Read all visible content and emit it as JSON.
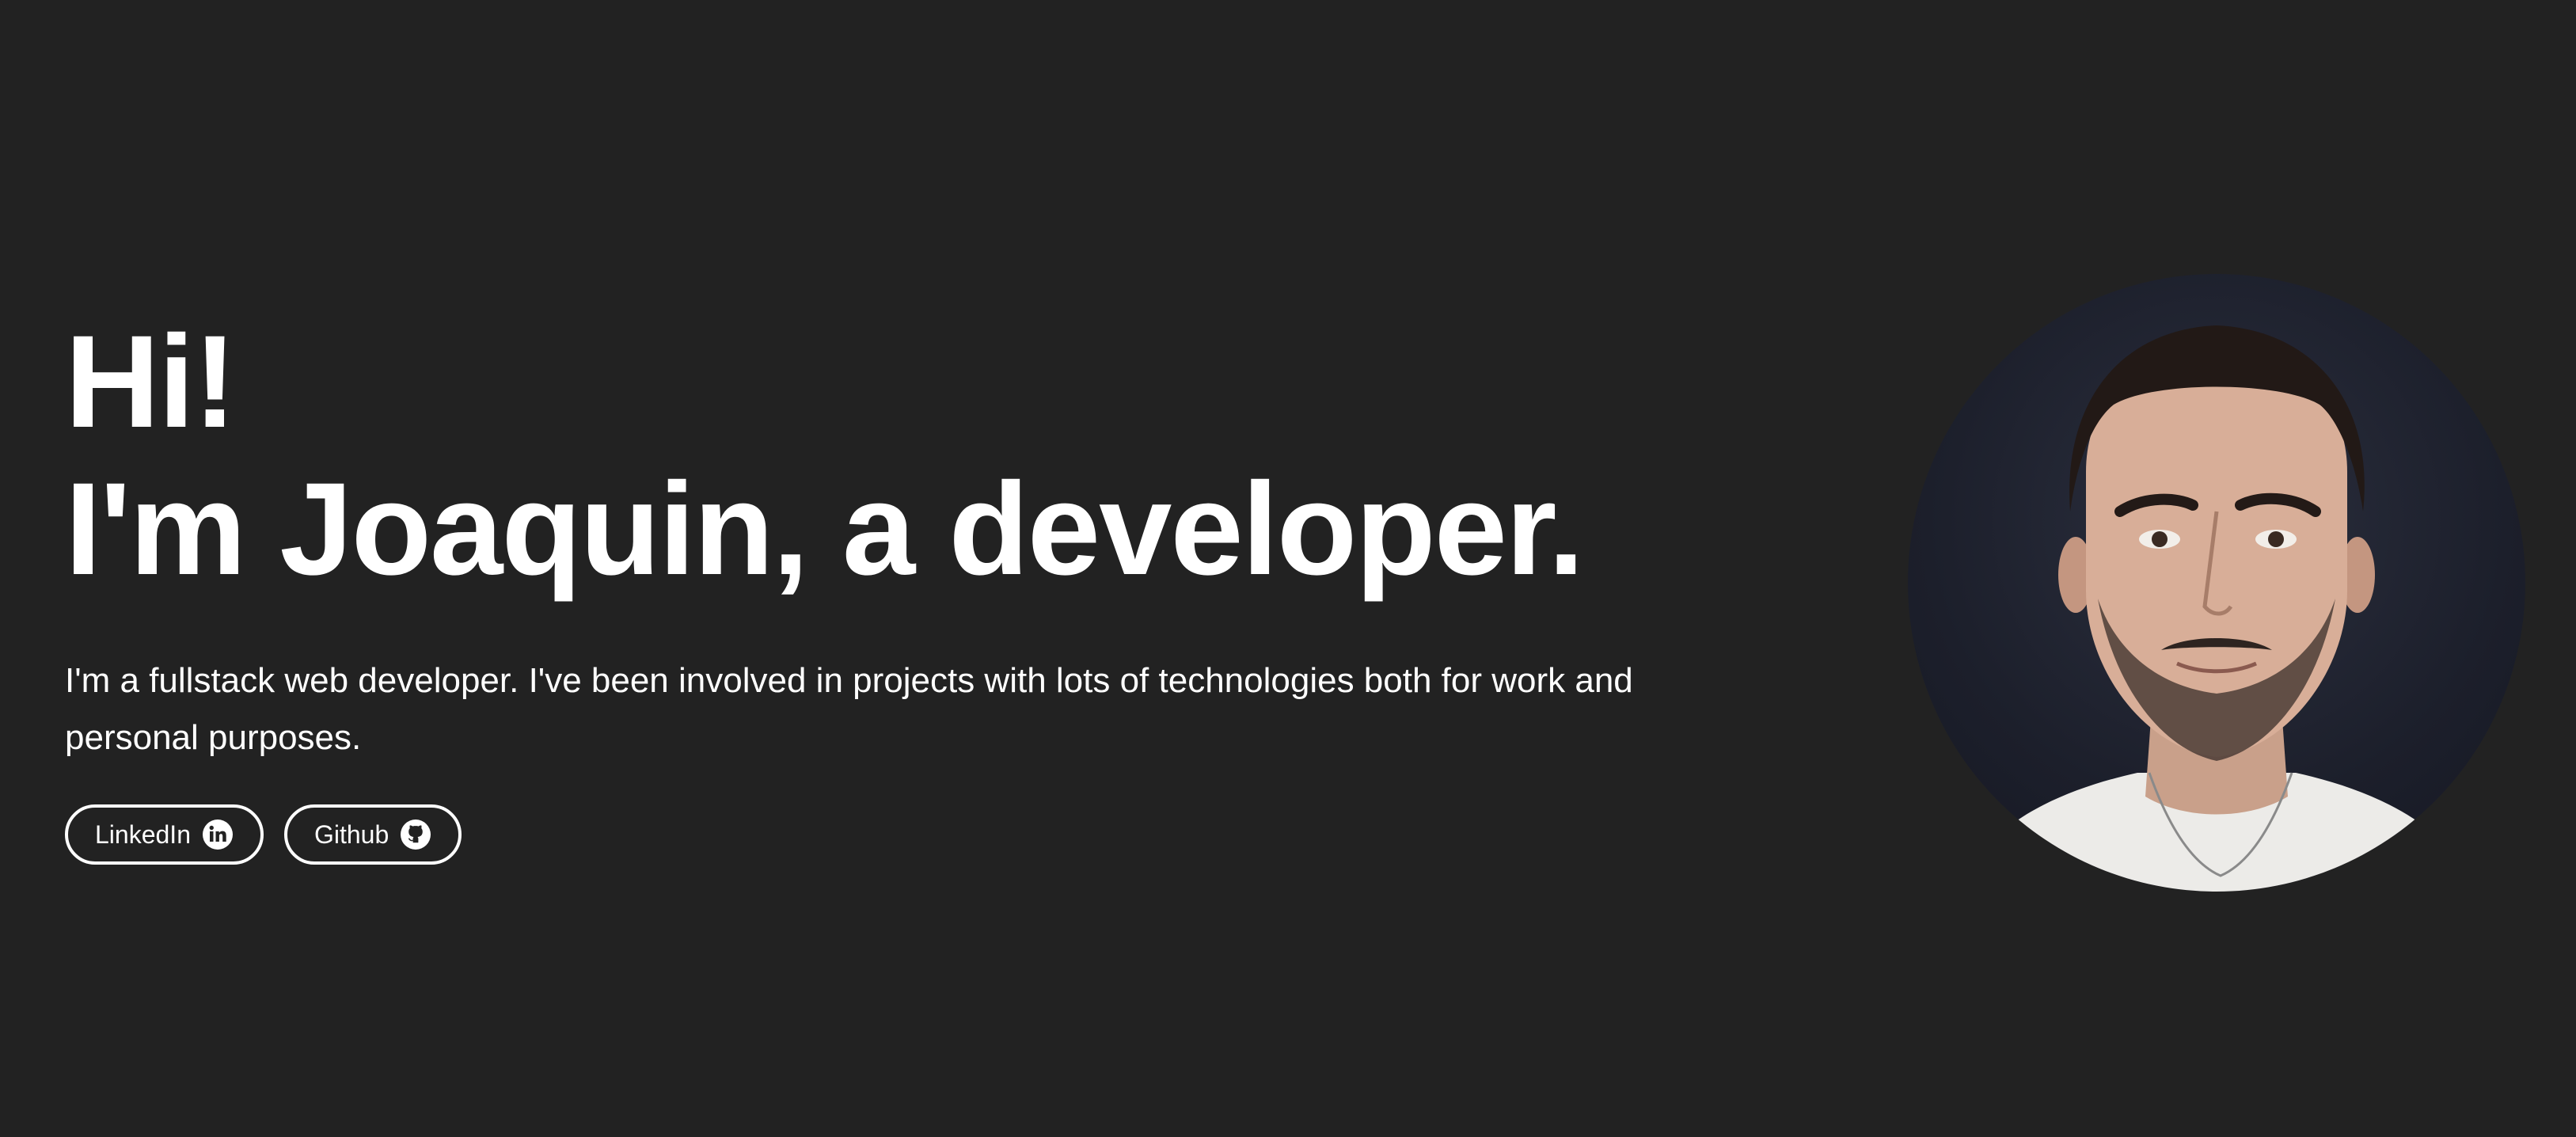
{
  "hero": {
    "greeting": "Hi!",
    "title": "I'm Joaquin, a developer.",
    "intro": "I'm a fullstack web developer. I've been involved in projects with lots of technologies both for work and personal purposes."
  },
  "links": [
    {
      "label": "LinkedIn",
      "icon": "linkedin-icon"
    },
    {
      "label": "Github",
      "icon": "github-icon"
    }
  ],
  "colors": {
    "background": "#222222",
    "text": "#ffffff"
  }
}
